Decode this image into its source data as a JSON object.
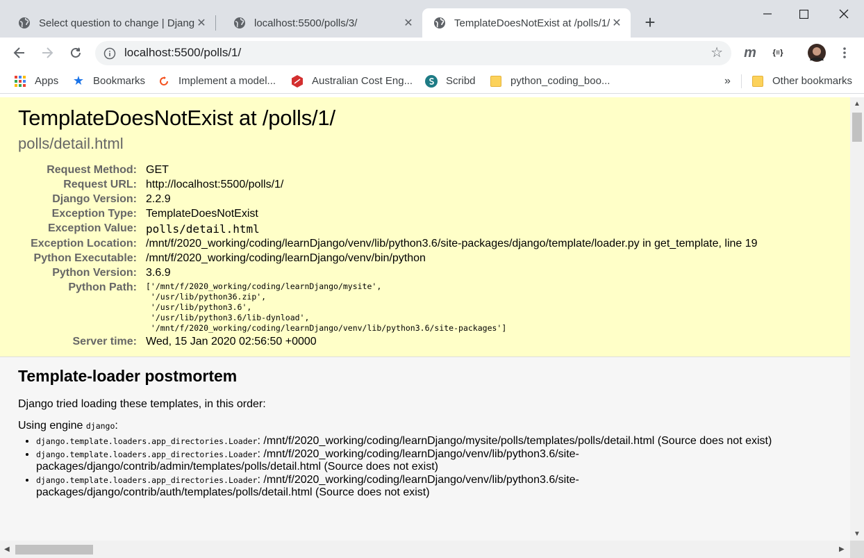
{
  "tabs": [
    {
      "title": "Select question to change | Django"
    },
    {
      "title": "localhost:5500/polls/3/"
    },
    {
      "title": "TemplateDoesNotExist at /polls/1/"
    }
  ],
  "new_tab_label": "+",
  "omnibox": {
    "url": "localhost:5500/polls/1/"
  },
  "extensions": {
    "m_label": "m",
    "json_label": "{≡}"
  },
  "bookmarks": {
    "items": [
      {
        "label": "Apps"
      },
      {
        "label": "Bookmarks"
      },
      {
        "label": "Implement a model..."
      },
      {
        "label": "Australian Cost Eng..."
      },
      {
        "label": "Scribd"
      },
      {
        "label": "python_coding_boo..."
      }
    ],
    "overflow": "»",
    "other": "Other bookmarks"
  },
  "error": {
    "title": "TemplateDoesNotExist at /polls/1/",
    "subtitle": "polls/detail.html",
    "rows": [
      {
        "label": "Request Method:",
        "value": "GET"
      },
      {
        "label": "Request URL:",
        "value": "http://localhost:5500/polls/1/"
      },
      {
        "label": "Django Version:",
        "value": "2.2.9"
      },
      {
        "label": "Exception Type:",
        "value": "TemplateDoesNotExist"
      },
      {
        "label": "Exception Value:",
        "value": "polls/detail.html"
      },
      {
        "label": "Exception Location:",
        "value": "/mnt/f/2020_working/coding/learnDjango/venv/lib/python3.6/site-packages/django/template/loader.py in get_template, line 19"
      },
      {
        "label": "Python Executable:",
        "value": "/mnt/f/2020_working/coding/learnDjango/venv/bin/python"
      },
      {
        "label": "Python Version:",
        "value": "3.6.9"
      },
      {
        "label": "Python Path:",
        "value": "['/mnt/f/2020_working/coding/learnDjango/mysite',\n '/usr/lib/python36.zip',\n '/usr/lib/python3.6',\n '/usr/lib/python3.6/lib-dynload',\n '/mnt/f/2020_working/coding/learnDjango/venv/lib/python3.6/site-packages']"
      },
      {
        "label": "Server time:",
        "value": "Wed, 15 Jan 2020 02:56:50 +0000"
      }
    ]
  },
  "postmortem": {
    "heading": "Template-loader postmortem",
    "intro": "Django tried loading these templates, in this order:",
    "engine_prefix": "Using engine ",
    "engine_name": "django",
    "engine_suffix": ":",
    "items": [
      {
        "loader": "django.template.loaders.app_directories.Loader",
        "text": ": /mnt/f/2020_working/coding/learnDjango/mysite/polls/templates/polls/detail.html (Source does not exist)"
      },
      {
        "loader": "django.template.loaders.app_directories.Loader",
        "text": ": /mnt/f/2020_working/coding/learnDjango/venv/lib/python3.6/site-packages/django/contrib/admin/templates/polls/detail.html (Source does not exist)"
      },
      {
        "loader": "django.template.loaders.app_directories.Loader",
        "text": ": /mnt/f/2020_working/coding/learnDjango/venv/lib/python3.6/site-packages/django/contrib/auth/templates/polls/detail.html (Source does not exist)"
      }
    ]
  },
  "colors": {
    "summary_bg": "#ffffc8",
    "page_bg": "#f6f6f6",
    "tabstrip_bg": "#dee1e6",
    "label_gray": "#666666"
  }
}
